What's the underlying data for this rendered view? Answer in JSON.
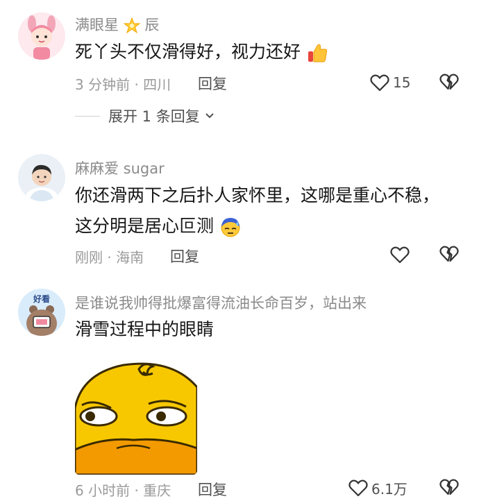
{
  "comments": [
    {
      "username": "满眼星",
      "username_suffix": "辰",
      "text": "死丫头不仅滑得好，视力还好",
      "time_location": "3 分钟前 · 四川",
      "reply_label": "回复",
      "like_count": "15",
      "expand_label": "展开 1 条回复"
    },
    {
      "username": "麻麻爱 sugar",
      "text_line1": "你还滑两下之后扑人家怀里，这哪是重心不稳，",
      "text_line2": "这分明是居心叵测",
      "time_location": "刚刚 · 海南",
      "reply_label": "回复"
    },
    {
      "username": "是谁说我帅得批爆富得流油长命百岁，站出来",
      "avatar_badge": "好看",
      "text": "滑雪过程中的眼睛",
      "time_location": "6 小时前 · 重庆",
      "reply_label": "回复",
      "like_count": "6.1万"
    }
  ],
  "icons": {
    "star": "star-emoji-icon",
    "thumbs_up": "thumbs-up-emoji-icon",
    "sweat_face": "sweat-face-emoji-icon",
    "heart": "heart-outline-icon",
    "broken_heart": "broken-heart-icon",
    "chevron": "chevron-down-icon"
  },
  "colors": {
    "username": "#8a8a8a",
    "body_text": "#161616",
    "meta": "#9a9a9a",
    "sticker_yellow": "#f7c800"
  }
}
